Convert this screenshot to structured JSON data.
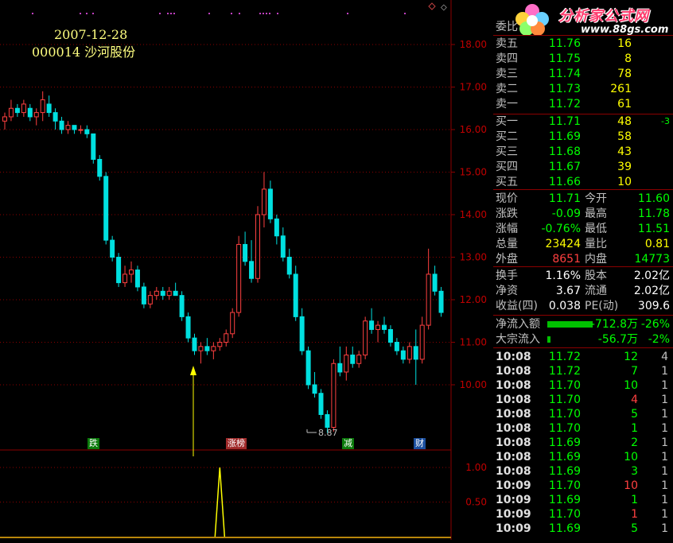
{
  "colors": {
    "up": "#ff4040",
    "down": "#00e0e0",
    "frame": "#8b0000",
    "yellow": "#ffff00",
    "green": "#00ff00",
    "label": "#c0c0c0"
  },
  "header": {
    "date": "2007-12-28",
    "stock": "000014 沙河股份"
  },
  "logo": {
    "title": "分析家公式网",
    "url": "www.88gs.com"
  },
  "y_axis": [
    "18.00",
    "17.00",
    "16.00",
    "15.00",
    "14.00",
    "13.00",
    "12.00",
    "11.00",
    "10.00"
  ],
  "sub_axis": [
    "1.00",
    "0.50"
  ],
  "low_marker": "8.87",
  "tags": [
    {
      "text": "跌",
      "bg": "#0b7a0b",
      "fg": "#ffffff"
    },
    {
      "text": "涨榜",
      "bg": "#a02a2a",
      "fg": "#ffffff"
    },
    {
      "text": "减",
      "bg": "#0b7a0b",
      "fg": "#ffffff"
    },
    {
      "text": "财",
      "bg": "#1b4fa0",
      "fg": "#ffffff"
    }
  ],
  "chart_data": {
    "type": "candlestick",
    "ylim": [
      8.0,
      18.5
    ],
    "candles": [
      [
        16.2,
        16.4,
        16.0,
        16.3
      ],
      [
        16.3,
        16.7,
        16.2,
        16.5
      ],
      [
        16.5,
        16.6,
        16.3,
        16.4
      ],
      [
        16.4,
        16.7,
        16.3,
        16.6
      ],
      [
        16.5,
        16.6,
        16.2,
        16.3
      ],
      [
        16.3,
        16.5,
        16.1,
        16.4
      ],
      [
        16.4,
        16.9,
        16.2,
        16.7
      ],
      [
        16.6,
        16.8,
        16.3,
        16.4
      ],
      [
        16.4,
        16.5,
        16.0,
        16.2
      ],
      [
        16.2,
        16.3,
        15.9,
        16.0
      ],
      [
        16.0,
        16.2,
        15.9,
        16.1
      ],
      [
        16.1,
        16.1,
        15.9,
        16.0
      ],
      [
        16.0,
        16.1,
        15.9,
        16.0
      ],
      [
        16.0,
        16.1,
        15.8,
        15.9
      ],
      [
        15.9,
        15.9,
        15.2,
        15.3
      ],
      [
        15.3,
        15.4,
        14.8,
        14.9
      ],
      [
        14.9,
        15.0,
        13.3,
        13.4
      ],
      [
        13.4,
        13.5,
        12.9,
        13.0
      ],
      [
        13.0,
        13.1,
        12.3,
        12.4
      ],
      [
        12.4,
        12.8,
        12.3,
        12.6
      ],
      [
        12.6,
        12.9,
        12.4,
        12.7
      ],
      [
        12.7,
        12.8,
        12.2,
        12.3
      ],
      [
        12.3,
        12.4,
        11.8,
        11.9
      ],
      [
        11.9,
        12.2,
        11.8,
        12.1
      ],
      [
        12.1,
        12.3,
        12.0,
        12.2
      ],
      [
        12.2,
        12.3,
        12.0,
        12.1
      ],
      [
        12.1,
        12.3,
        12.0,
        12.2
      ],
      [
        12.2,
        12.4,
        12.1,
        12.1
      ],
      [
        12.1,
        12.2,
        11.5,
        11.6
      ],
      [
        11.6,
        11.7,
        11.0,
        11.1
      ],
      [
        11.1,
        11.2,
        10.7,
        10.8
      ],
      [
        10.8,
        11.0,
        10.5,
        10.9
      ],
      [
        10.9,
        11.1,
        10.7,
        10.8
      ],
      [
        10.8,
        11.0,
        10.6,
        10.9
      ],
      [
        10.9,
        11.1,
        10.8,
        11.0
      ],
      [
        11.0,
        11.3,
        10.9,
        11.2
      ],
      [
        11.2,
        11.8,
        11.1,
        11.7
      ],
      [
        11.7,
        13.5,
        11.6,
        13.3
      ],
      [
        13.3,
        13.6,
        12.8,
        12.9
      ],
      [
        12.9,
        13.4,
        12.4,
        12.5
      ],
      [
        12.5,
        14.2,
        12.4,
        14.0
      ],
      [
        14.0,
        15.0,
        13.7,
        14.6
      ],
      [
        14.6,
        14.8,
        13.8,
        13.9
      ],
      [
        13.9,
        14.0,
        13.3,
        13.5
      ],
      [
        13.5,
        13.7,
        12.9,
        13.0
      ],
      [
        13.0,
        13.2,
        12.5,
        12.6
      ],
      [
        12.6,
        12.8,
        11.5,
        11.6
      ],
      [
        11.6,
        11.8,
        10.7,
        10.8
      ],
      [
        10.8,
        10.9,
        9.9,
        10.0
      ],
      [
        10.0,
        10.3,
        9.7,
        9.8
      ],
      [
        9.8,
        9.9,
        9.2,
        9.3
      ],
      [
        9.3,
        9.4,
        8.87,
        9.0
      ],
      [
        9.0,
        10.6,
        8.9,
        10.5
      ],
      [
        10.5,
        10.9,
        10.2,
        10.3
      ],
      [
        10.3,
        10.9,
        10.1,
        10.7
      ],
      [
        10.7,
        10.9,
        10.4,
        10.5
      ],
      [
        10.5,
        10.8,
        10.4,
        10.7
      ],
      [
        10.7,
        11.6,
        10.6,
        11.5
      ],
      [
        11.5,
        11.8,
        11.2,
        11.3
      ],
      [
        11.3,
        11.5,
        11.0,
        11.4
      ],
      [
        11.4,
        11.6,
        11.2,
        11.3
      ],
      [
        11.3,
        11.4,
        10.9,
        11.0
      ],
      [
        11.0,
        11.1,
        10.7,
        10.8
      ],
      [
        10.8,
        10.9,
        10.5,
        10.6
      ],
      [
        10.6,
        11.0,
        10.5,
        10.9
      ],
      [
        10.9,
        11.3,
        10.0,
        10.6
      ],
      [
        10.6,
        11.6,
        10.5,
        11.4
      ],
      [
        11.4,
        13.2,
        11.3,
        12.6
      ],
      [
        12.6,
        12.8,
        12.1,
        12.2
      ],
      [
        12.2,
        12.3,
        11.6,
        11.7
      ]
    ],
    "indicator_peak_index": 34,
    "indicator_ylim": [
      0,
      1.2
    ]
  },
  "panel": {
    "weibi_label": "委比",
    "sells": [
      {
        "label": "卖五",
        "price": "11.76",
        "vol": "16"
      },
      {
        "label": "卖四",
        "price": "11.75",
        "vol": "8"
      },
      {
        "label": "卖三",
        "price": "11.74",
        "vol": "78"
      },
      {
        "label": "卖二",
        "price": "11.73",
        "vol": "261"
      },
      {
        "label": "卖一",
        "price": "11.72",
        "vol": "61"
      }
    ],
    "buys": [
      {
        "label": "买一",
        "price": "11.71",
        "vol": "48",
        "chg": "-3"
      },
      {
        "label": "买二",
        "price": "11.69",
        "vol": "58",
        "chg": ""
      },
      {
        "label": "买三",
        "price": "11.68",
        "vol": "43",
        "chg": ""
      },
      {
        "label": "买四",
        "price": "11.67",
        "vol": "39",
        "chg": ""
      },
      {
        "label": "买五",
        "price": "11.66",
        "vol": "10",
        "chg": ""
      }
    ],
    "stats": [
      {
        "l1": "现价",
        "v1": "11.71",
        "c1": "#00ff00",
        "l2": "今开",
        "v2": "11.60",
        "c2": "#00ff00"
      },
      {
        "l1": "涨跌",
        "v1": "-0.09",
        "c1": "#00ff00",
        "l2": "最高",
        "v2": "11.78",
        "c2": "#00ff00"
      },
      {
        "l1": "涨幅",
        "v1": "-0.76%",
        "c1": "#00ff00",
        "l2": "最低",
        "v2": "11.51",
        "c2": "#00ff00"
      },
      {
        "l1": "总量",
        "v1": "23424",
        "c1": "#ffff00",
        "l2": "量比",
        "v2": "0.81",
        "c2": "#ffff00"
      },
      {
        "l1": "外盘",
        "v1": "8651",
        "c1": "#ff4040",
        "l2": "内盘",
        "v2": "14773",
        "c2": "#00ff00"
      }
    ],
    "stats2": [
      {
        "l1": "换手",
        "v1": "1.16%",
        "l2": "股本",
        "v2": "2.02亿"
      },
      {
        "l1": "净资",
        "v1": "3.67",
        "l2": "流通",
        "v2": "2.02亿"
      },
      {
        "l1": "收益(四)",
        "v1": "0.038",
        "l2": "PE(动)",
        "v2": "309.6"
      }
    ],
    "flows": [
      {
        "label": "净流入额",
        "amount": "-712.8万",
        "pct": "-26%",
        "bar": 0.26
      },
      {
        "label": "大宗流入",
        "amount": "-56.7万",
        "pct": "-2%",
        "bar": 0.02
      }
    ],
    "ticks": [
      {
        "t": "10:08",
        "p": "11.72",
        "v": "12",
        "n": "4",
        "vc": "#00ff00"
      },
      {
        "t": "10:08",
        "p": "11.72",
        "v": "7",
        "n": "1",
        "vc": "#00ff00"
      },
      {
        "t": "10:08",
        "p": "11.70",
        "v": "10",
        "n": "1",
        "vc": "#00ff00"
      },
      {
        "t": "10:08",
        "p": "11.70",
        "v": "4",
        "n": "1",
        "vc": "#ff4040"
      },
      {
        "t": "10:08",
        "p": "11.70",
        "v": "5",
        "n": "1",
        "vc": "#00ff00"
      },
      {
        "t": "10:08",
        "p": "11.70",
        "v": "1",
        "n": "1",
        "vc": "#00ff00"
      },
      {
        "t": "10:08",
        "p": "11.69",
        "v": "2",
        "n": "1",
        "vc": "#00ff00"
      },
      {
        "t": "10:08",
        "p": "11.69",
        "v": "10",
        "n": "1",
        "vc": "#00ff00"
      },
      {
        "t": "10:08",
        "p": "11.69",
        "v": "3",
        "n": "1",
        "vc": "#00ff00"
      },
      {
        "t": "10:09",
        "p": "11.70",
        "v": "10",
        "n": "1",
        "vc": "#ff4040"
      },
      {
        "t": "10:09",
        "p": "11.69",
        "v": "1",
        "n": "1",
        "vc": "#00ff00"
      },
      {
        "t": "10:09",
        "p": "11.70",
        "v": "1",
        "n": "1",
        "vc": "#ff4040"
      },
      {
        "t": "10:09",
        "p": "11.69",
        "v": "5",
        "n": "1",
        "vc": "#00ff00"
      }
    ]
  }
}
